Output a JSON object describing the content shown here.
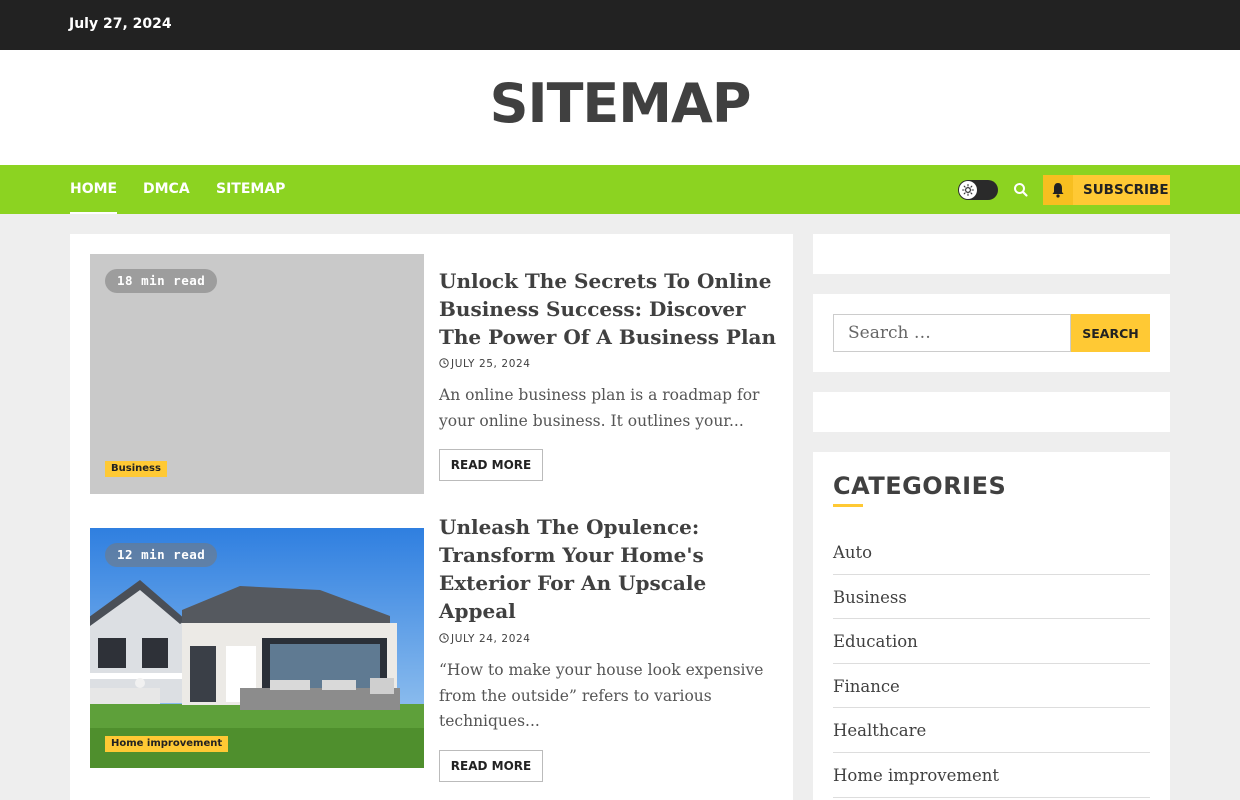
{
  "topbar": {
    "date": "July 27, 2024"
  },
  "site": {
    "title": "SITEMAP"
  },
  "nav": {
    "items": [
      {
        "label": "HOME",
        "active": true
      },
      {
        "label": "DMCA",
        "active": false
      },
      {
        "label": "SITEMAP",
        "active": false
      }
    ],
    "subscribe_label": "SUBSCRIBE",
    "icons": [
      "sun-icon",
      "search-icon",
      "bell-icon"
    ],
    "accent": "#8cd321"
  },
  "posts": [
    {
      "read_time": "18 min read",
      "category": "Business",
      "title": "Unlock The Secrets To Online Business Success: Discover The Power Of A Business Plan",
      "date": "JULY 25, 2024",
      "excerpt": "An online business plan is a roadmap for your online business. It outlines your...",
      "read_more": "READ MORE"
    },
    {
      "read_time": "12 min read",
      "category": "Home improvement",
      "title": "Unleash The Opulence: Transform Your Home's Exterior For An Upscale Appeal",
      "date": "JULY 24, 2024",
      "excerpt": "“How to make your house look expensive from the outside” refers to various techniques...",
      "read_more": "READ MORE"
    }
  ],
  "sidebar": {
    "search": {
      "placeholder": "Search …",
      "button_label": "SEARCH"
    },
    "categories": {
      "heading": "CATEGORIES",
      "items": [
        "Auto",
        "Business",
        "Education",
        "Finance",
        "Healthcare",
        "Home improvement"
      ]
    }
  },
  "colors": {
    "topbar": "#222222",
    "nav": "#8cd321",
    "highlight": "#ffc934"
  }
}
